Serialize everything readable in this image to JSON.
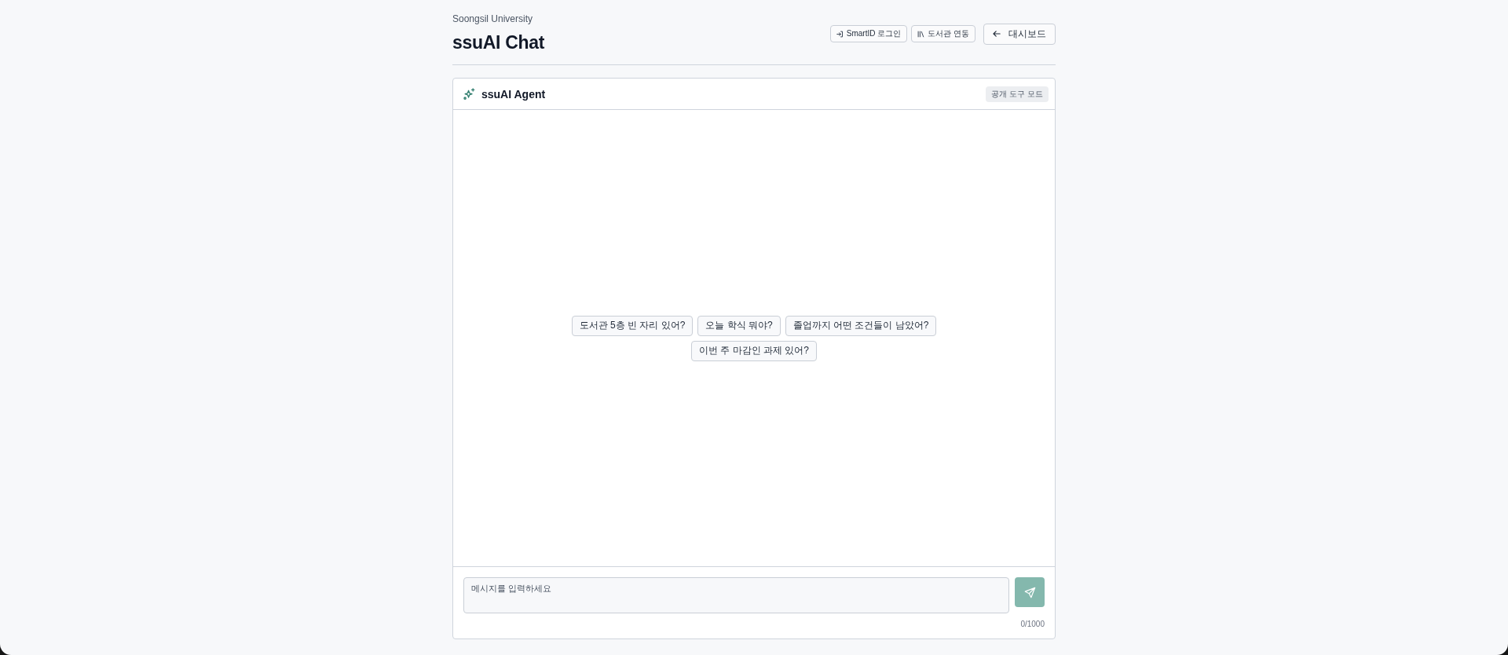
{
  "header": {
    "subtitle": "Soongsil University",
    "title": "ssuAI Chat",
    "actions": [
      {
        "kind": "login",
        "label": "SmartID 로그인"
      },
      {
        "kind": "library",
        "label": "도서관 연동"
      },
      {
        "kind": "back",
        "label": "대시보드"
      }
    ]
  },
  "chat": {
    "title": "ssuAI Agent",
    "mode_badge": "공개 도구 모드",
    "suggestions": [
      "도서관 5층 빈 자리 있어?",
      "오늘 학식 뭐야?",
      "졸업까지 어떤 조건들이 남았어?",
      "이번 주 마감인 과제 있어?"
    ],
    "composer": {
      "placeholder": "메시지를 입력하세요",
      "counter": "0/1000",
      "send_button": {
        "disabled": true
      }
    }
  }
}
